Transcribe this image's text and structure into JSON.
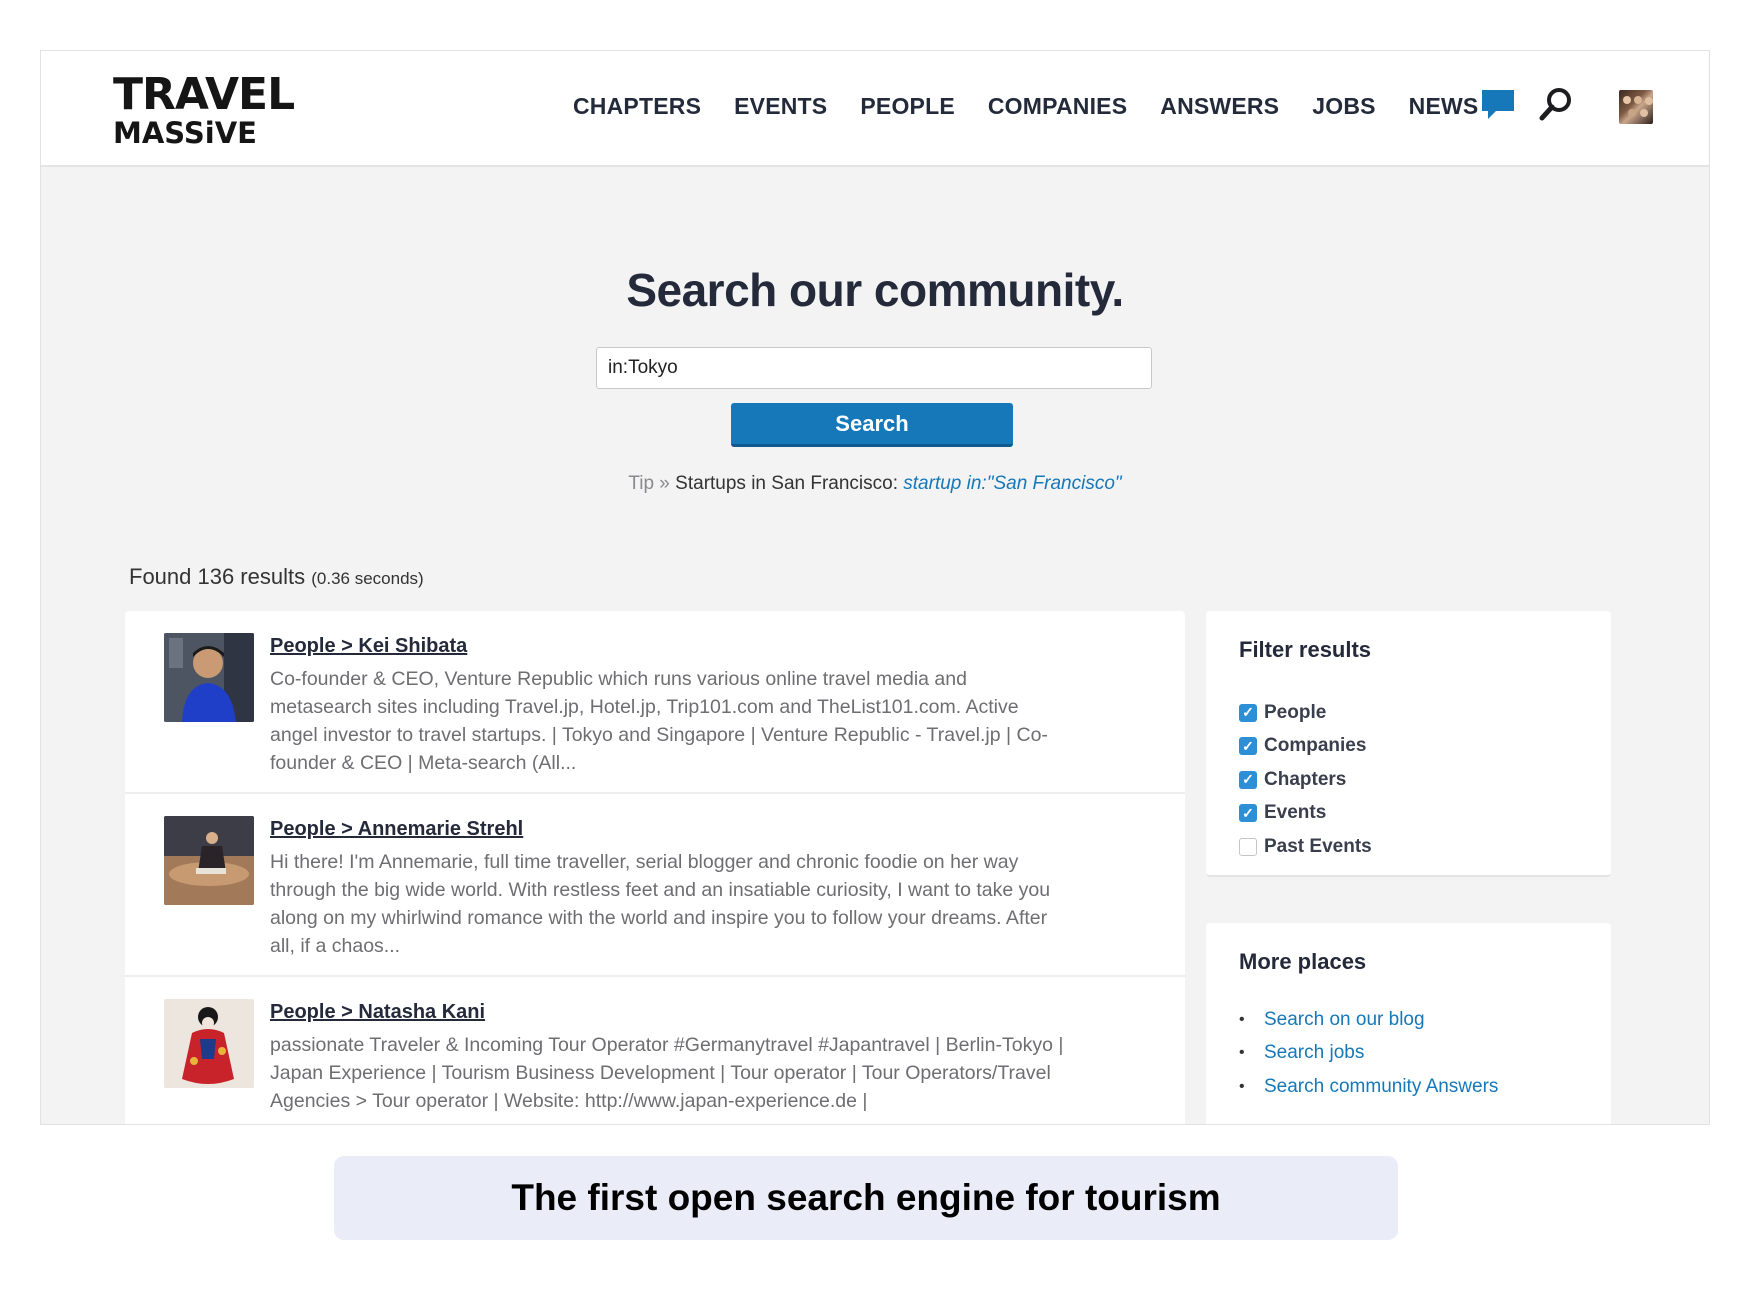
{
  "brand": {
    "line1": "TRAVEL",
    "line2": "MASSiVE"
  },
  "nav": [
    "CHAPTERS",
    "EVENTS",
    "PEOPLE",
    "COMPANIES",
    "ANSWERS",
    "JOBS",
    "NEWS"
  ],
  "header_icons": [
    "chat-bubble-icon",
    "search-icon",
    "user-avatar"
  ],
  "colors": {
    "accent": "#1678b8",
    "heading": "#242a3a",
    "background": "#f3f3f4"
  },
  "hero": {
    "title": "Search our community.",
    "input_value": "in:Tokyo",
    "button_label": "Search",
    "tip_prefix": "Tip »",
    "tip_text": "Startups in San Francisco:",
    "tip_example": "startup in:\"San Francisco\""
  },
  "results": {
    "found_text": "Found 136 results",
    "time_text": "(0.36 seconds)",
    "items": [
      {
        "title": "People > Kei Shibata",
        "description": "Co-founder & CEO, Venture Republic which runs various online travel media and metasearch sites including Travel.jp, Hotel.jp, Trip101.com and TheList101.com. Active angel investor to travel startups. | Tokyo and Singapore | Venture Republic - Travel.jp | Co-founder & CEO | Meta-search (All..."
      },
      {
        "title": "People > Annemarie Strehl",
        "description": "Hi there! I'm Annemarie, full time traveller, serial blogger and chronic foodie on her way through the big wide world. With restless feet and an insatiable curiosity, I want to take you along on my whirlwind romance with the world and inspire you to follow your dreams. After all, if a chaos..."
      },
      {
        "title": "People > Natasha Kani",
        "description": "passionate Traveler & Incoming Tour Operator #Germanytravel #Japantravel | Berlin-Tokyo | Japan Experience | Tourism Business Development | Tour operator | Tour Operators/Travel Agencies > Tour operator | Website: http://www.japan-experience.de |"
      }
    ]
  },
  "filter": {
    "title": "Filter results",
    "options": [
      {
        "label": "People",
        "checked": true
      },
      {
        "label": "Companies",
        "checked": true
      },
      {
        "label": "Chapters",
        "checked": true
      },
      {
        "label": "Events",
        "checked": true
      },
      {
        "label": "Past Events",
        "checked": false
      }
    ]
  },
  "more_places": {
    "title": "More places",
    "links": [
      "Search on our blog",
      "Search jobs",
      "Search community Answers"
    ]
  },
  "caption": "The first open search engine for tourism"
}
